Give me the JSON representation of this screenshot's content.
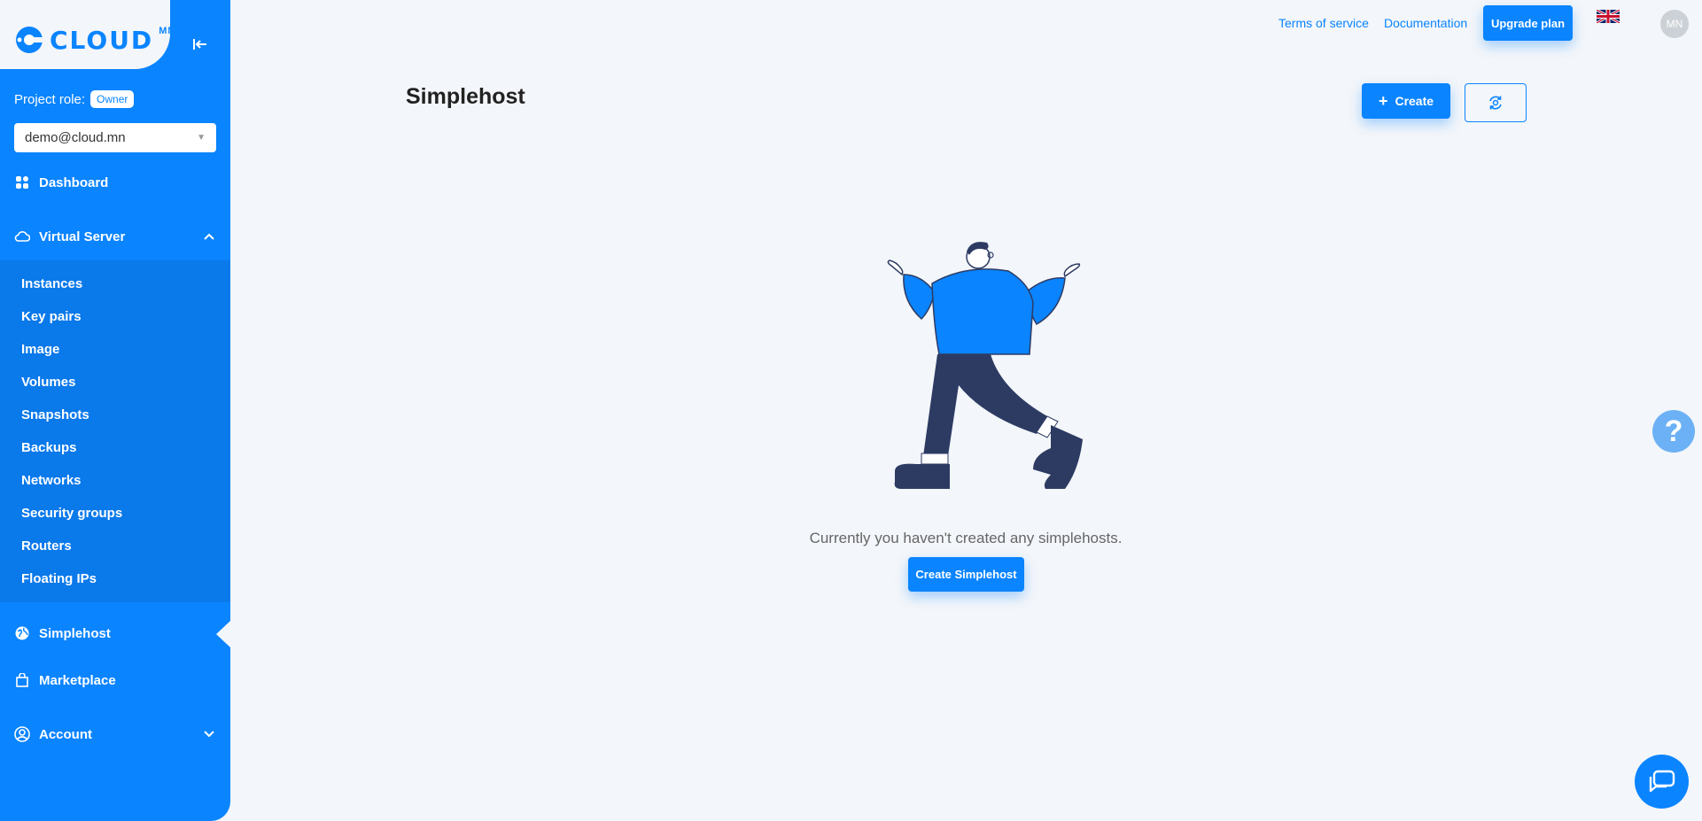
{
  "brand": {
    "name": "CLOUD",
    "superscript": "MN"
  },
  "sidebar": {
    "role_label": "Project role:",
    "role_badge": "Owner",
    "project_select": "demo@cloud.mn",
    "dashboard": "Dashboard",
    "virtual_server": "Virtual Server",
    "sub_items": [
      "Instances",
      "Key pairs",
      "Image",
      "Volumes",
      "Snapshots",
      "Backups",
      "Networks",
      "Security groups",
      "Routers",
      "Floating IPs"
    ],
    "simplehost": "Simplehost",
    "marketplace": "Marketplace",
    "account": "Account"
  },
  "topbar": {
    "terms": "Terms of service",
    "documentation": "Documentation",
    "upgrade": "Upgrade plan",
    "avatar_initials": "MN"
  },
  "main": {
    "title": "Simplehost",
    "create_label": "Create",
    "empty_message": "Currently you haven't created any simplehosts.",
    "create_simplehost_label": "Create Simplehost"
  },
  "help": {
    "symbol": "?"
  },
  "colors": {
    "accent": "#0a84ff",
    "background": "#f3f6fa"
  }
}
